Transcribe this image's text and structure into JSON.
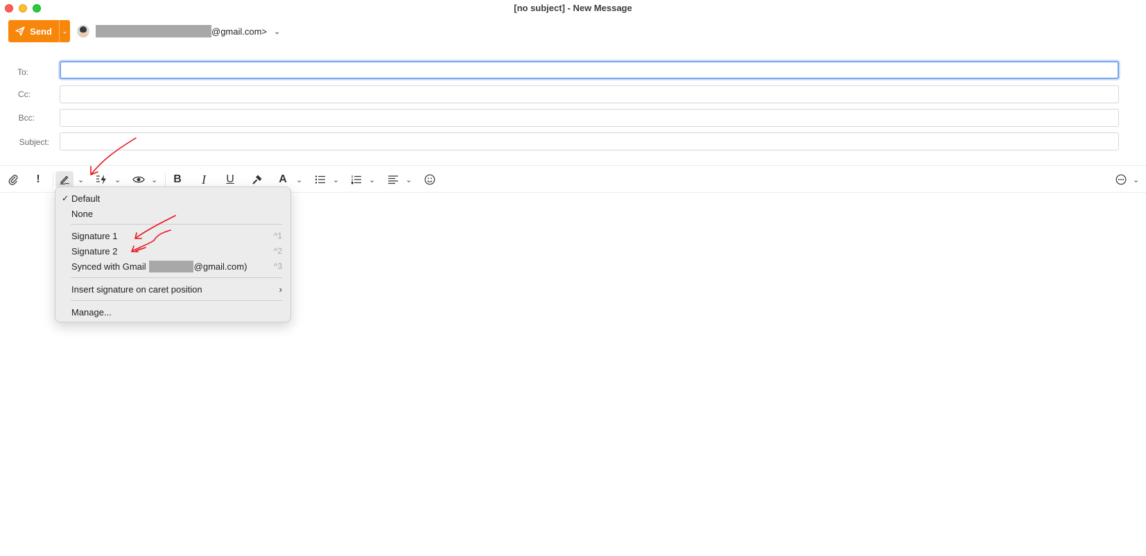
{
  "window": {
    "title": "[no subject] - New Message"
  },
  "toolbar_top": {
    "send_label": "Send",
    "from_suffix": "@gmail.com>"
  },
  "fields": {
    "to_label": "To:",
    "cc_label": "Cc:",
    "bcc_label": "Bcc:",
    "subject_label": "Subject:",
    "to_value": "",
    "cc_value": "",
    "bcc_value": "",
    "subject_value": ""
  },
  "format_toolbar": {
    "icons": [
      "paperclip-icon",
      "priority-icon",
      "signature-icon",
      "quick-text-icon",
      "preview-icon",
      "bold-icon",
      "italic-icon",
      "underline-icon",
      "format-painter-icon",
      "font-color-icon",
      "bullet-list-icon",
      "numbered-list-icon",
      "align-icon",
      "emoji-icon",
      "more-icon"
    ],
    "bold": "B",
    "italic": "I",
    "underline": "U",
    "font": "A"
  },
  "signature_menu": {
    "selected": "Default",
    "items": [
      {
        "label": "Default",
        "checked": "✓"
      },
      {
        "label": "None"
      },
      {
        "label": "Signature 1",
        "shortcut": "^1"
      },
      {
        "label": "Signature 2",
        "shortcut": "^2"
      },
      {
        "label_prefix": "Synced with Gmail",
        "label_suffix": "@gmail.com)",
        "shortcut": "^3"
      },
      {
        "label": "Insert signature on caret position"
      },
      {
        "label": "Manage..."
      }
    ]
  },
  "colors": {
    "accent": "#f7860a",
    "annotation": "#e8141b",
    "focus": "#79a6ea"
  }
}
